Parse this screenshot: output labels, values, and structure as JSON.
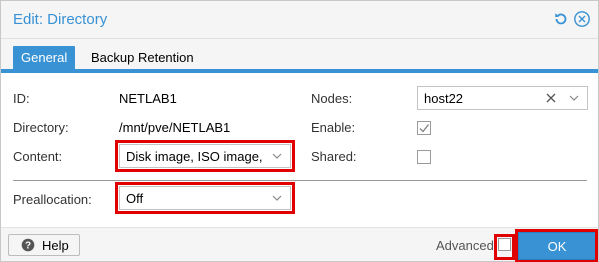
{
  "dialog": {
    "title": "Edit: Directory",
    "reset_icon": "reset-icon",
    "close_icon": "close-icon"
  },
  "tabs": [
    {
      "label": "General",
      "active": true
    },
    {
      "label": "Backup Retention",
      "active": false
    }
  ],
  "form": {
    "id_label": "ID:",
    "id_value": "NETLAB1",
    "directory_label": "Directory:",
    "directory_value": "/mnt/pve/NETLAB1",
    "content_label": "Content:",
    "content_value": "Disk image, ISO image,",
    "nodes_label": "Nodes:",
    "nodes_value": "host22",
    "enable_label": "Enable:",
    "enable_checked": true,
    "shared_label": "Shared:",
    "shared_checked": false,
    "preallocation_label": "Preallocation:",
    "preallocation_value": "Off"
  },
  "footer": {
    "help_label": "Help",
    "advanced_label": "Advanced",
    "advanced_checked": false,
    "ok_label": "OK"
  },
  "colors": {
    "accent": "#3892d4",
    "highlight_box": "#e10000"
  }
}
